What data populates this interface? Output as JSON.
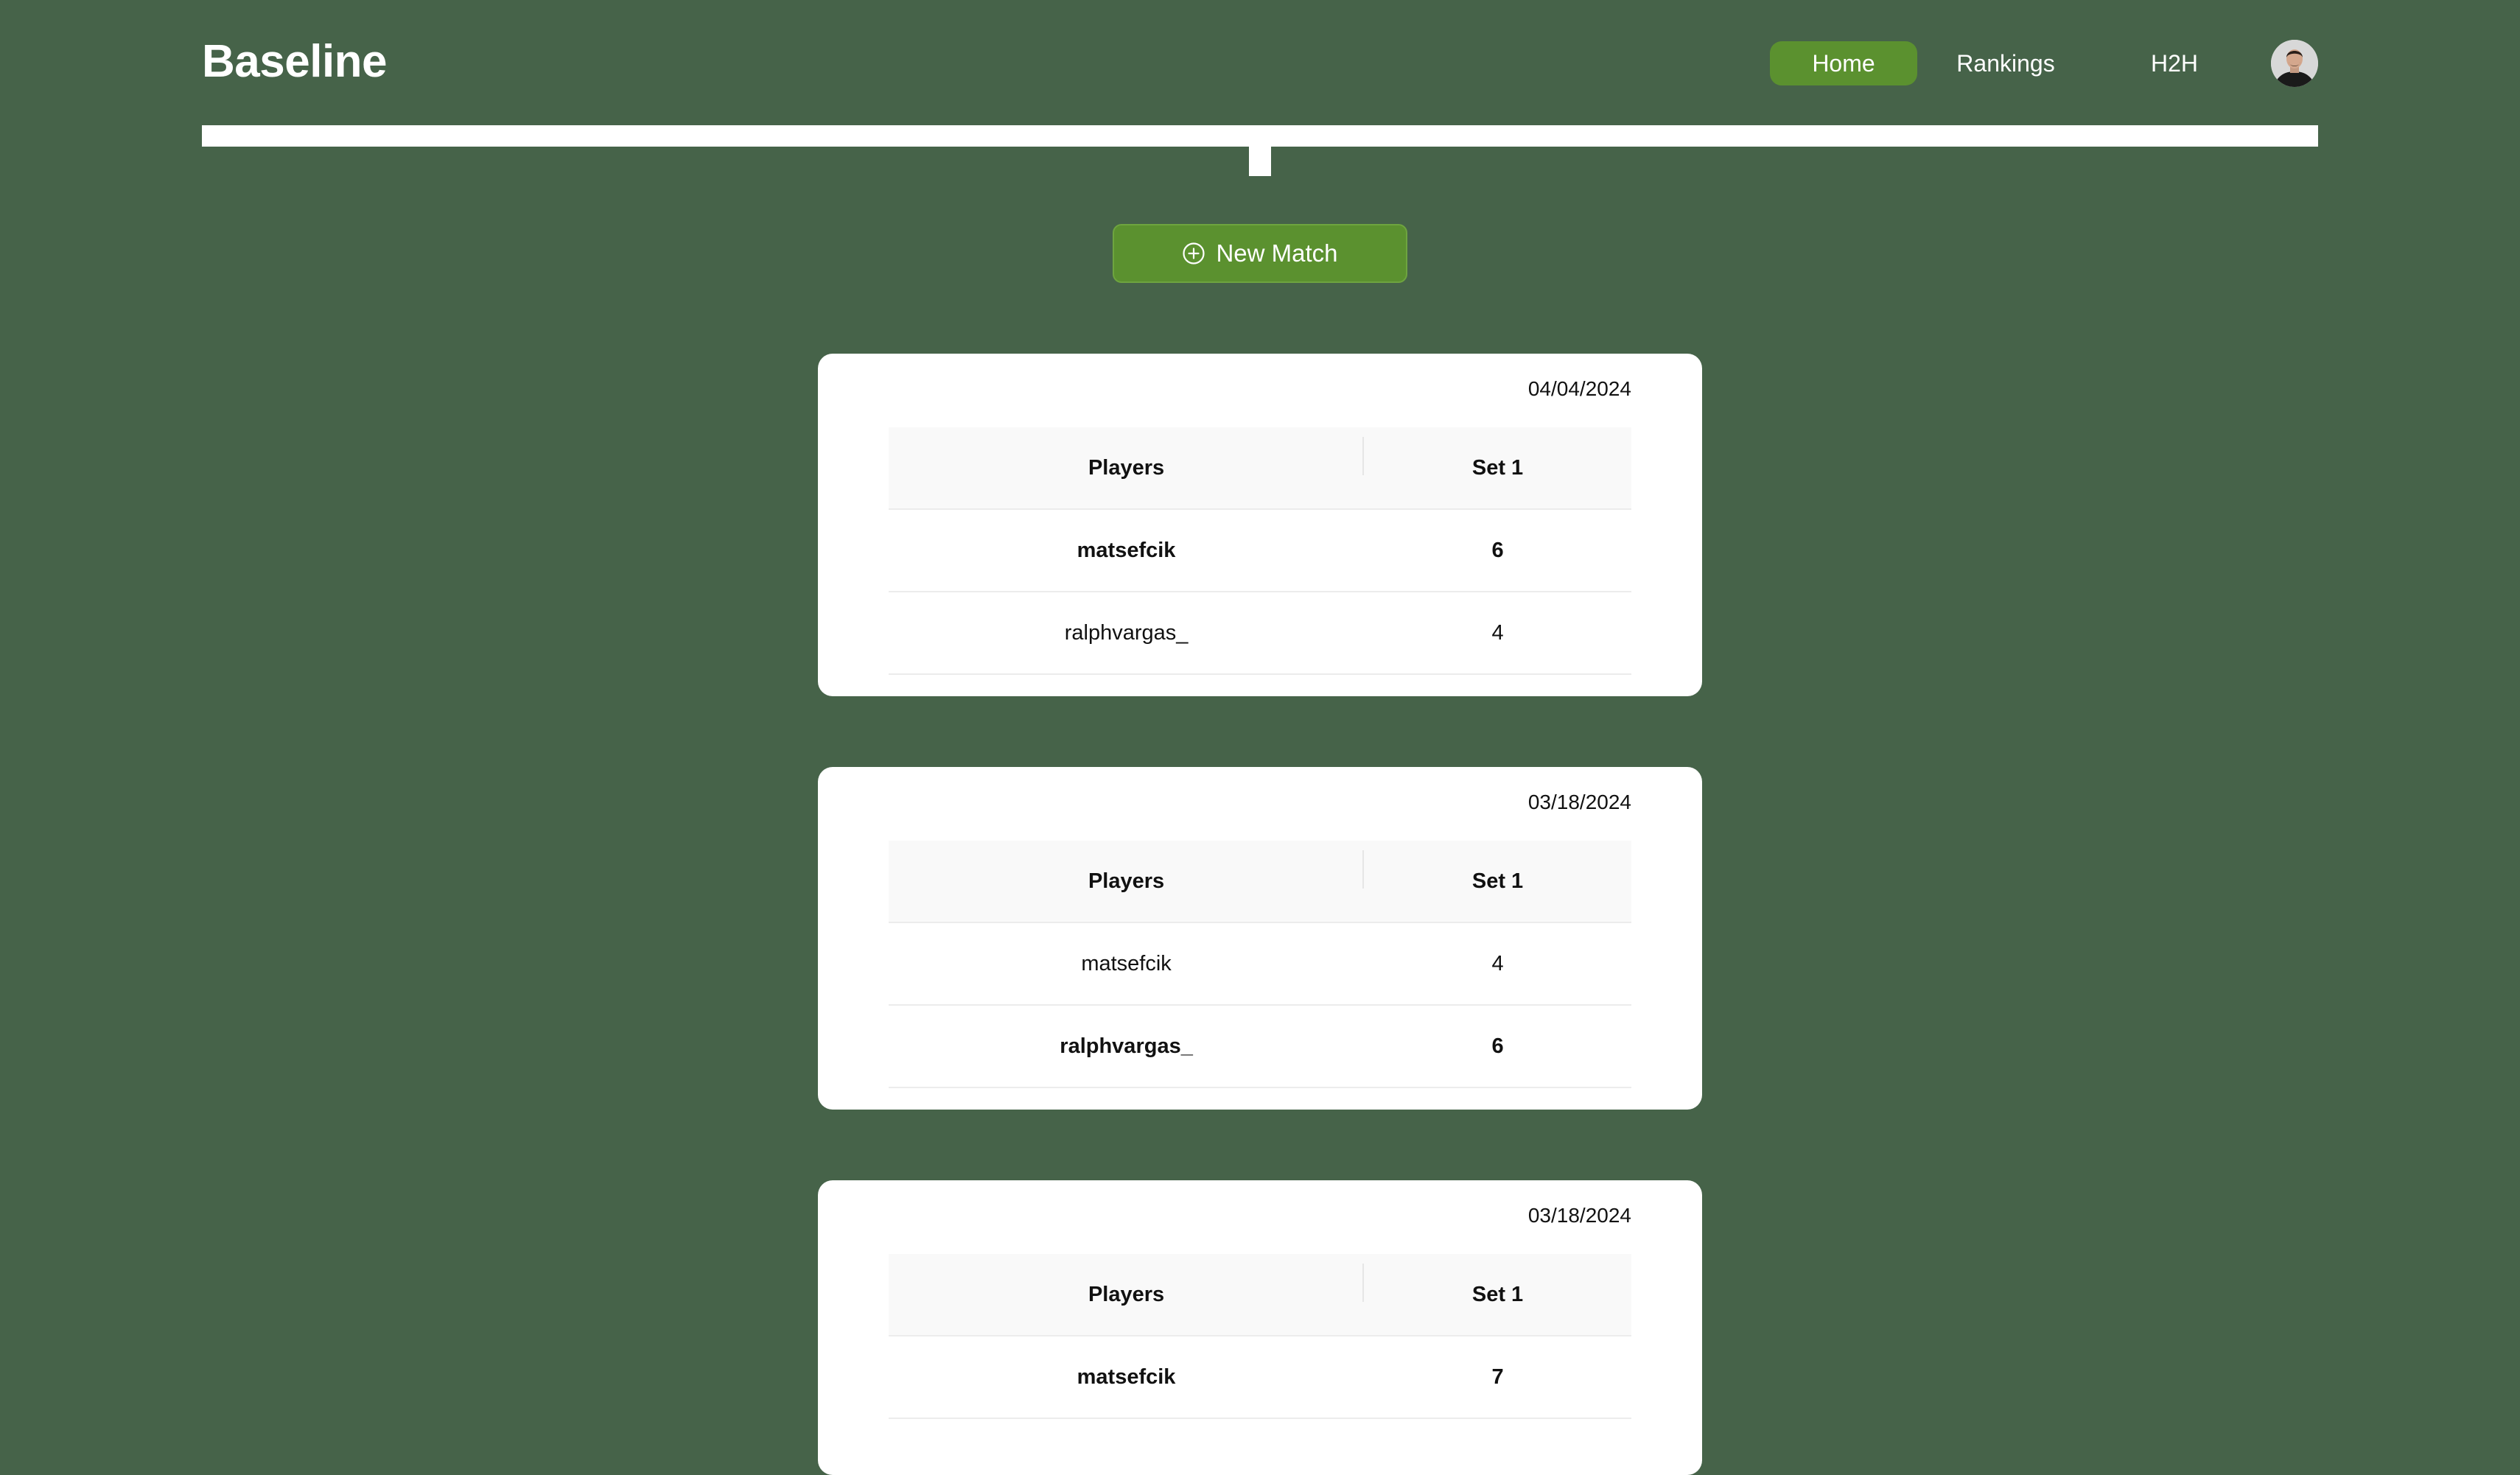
{
  "app": {
    "title": "Baseline"
  },
  "nav": {
    "home": "Home",
    "rankings": "Rankings",
    "h2h": "H2H"
  },
  "actions": {
    "new_match": "New Match"
  },
  "matches": [
    {
      "date": "04/04/2024",
      "headers": {
        "players": "Players",
        "set1": "Set 1"
      },
      "rows": [
        {
          "player": "matsefcik",
          "set1": "6",
          "winner": true
        },
        {
          "player": "ralphvargas_",
          "set1": "4",
          "winner": false
        }
      ]
    },
    {
      "date": "03/18/2024",
      "headers": {
        "players": "Players",
        "set1": "Set 1"
      },
      "rows": [
        {
          "player": "matsefcik",
          "set1": "4",
          "winner": false
        },
        {
          "player": "ralphvargas_",
          "set1": "6",
          "winner": true
        }
      ]
    },
    {
      "date": "03/18/2024",
      "headers": {
        "players": "Players",
        "set1": "Set 1"
      },
      "rows": [
        {
          "player": "matsefcik",
          "set1": "7",
          "winner": true
        }
      ]
    }
  ],
  "colors": {
    "background": "#466349",
    "accent": "#5b912f"
  },
  "icons": {
    "new_match": "plus-circle-icon",
    "avatar": "user-avatar"
  }
}
